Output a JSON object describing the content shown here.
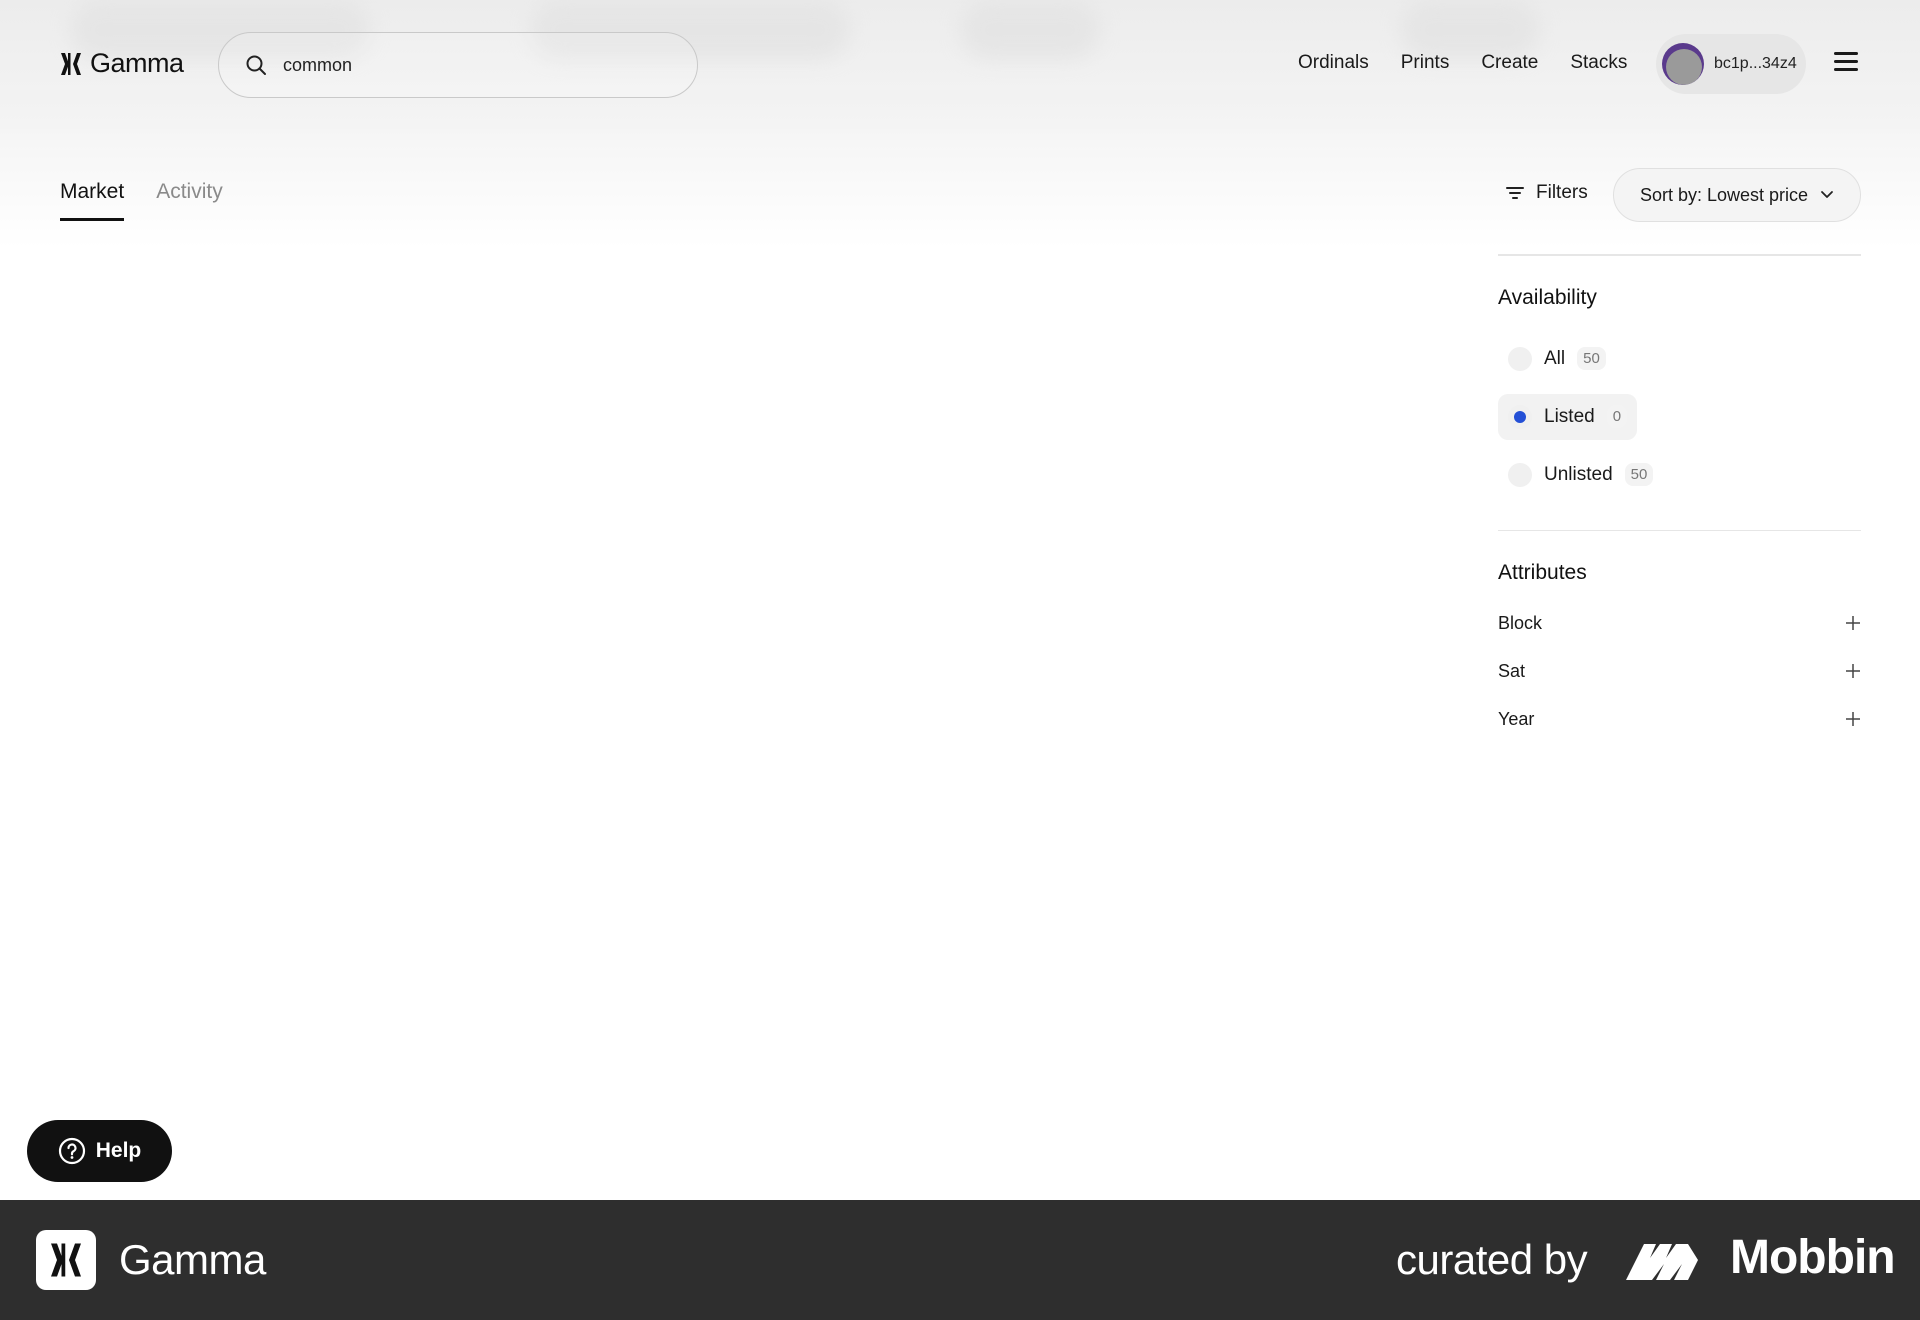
{
  "app": {
    "name": "Gamma"
  },
  "search": {
    "value": "common",
    "icon": "search-icon"
  },
  "nav": {
    "items": [
      "Ordinals",
      "Prints",
      "Create",
      "Stacks"
    ]
  },
  "wallet": {
    "address": "bc1p...34z4"
  },
  "tabs": [
    {
      "label": "Market",
      "active": true
    },
    {
      "label": "Activity",
      "active": false
    }
  ],
  "toolbar": {
    "filters_label": "Filters",
    "sort_label": "Sort by: Lowest price"
  },
  "availability": {
    "title": "Availability",
    "options": [
      {
        "label": "All",
        "count": "50",
        "selected": false
      },
      {
        "label": "Listed",
        "count": "0",
        "selected": true
      },
      {
        "label": "Unlisted",
        "count": "50",
        "selected": false
      }
    ]
  },
  "attributes": {
    "title": "Attributes",
    "items": [
      "Block",
      "Sat",
      "Year"
    ]
  },
  "help": {
    "label": "Help"
  },
  "footer": {
    "brand": "Gamma",
    "curated_by": "curated by",
    "mobbin": "Mobbin"
  },
  "colors": {
    "accent": "#2450d6",
    "footer_bg": "#2e2e2e",
    "help_bg": "#111111"
  }
}
